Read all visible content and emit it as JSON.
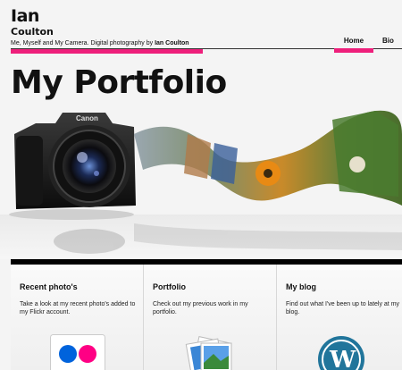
{
  "header": {
    "logo_first": "Ian",
    "logo_last": "Coulton",
    "tagline_text": "Me, Myself and My Camera. Digital photography by ",
    "tagline_name": "Ian Coulton"
  },
  "nav": {
    "items": [
      {
        "label": "Home",
        "active": true
      },
      {
        "label": "Bio",
        "active": false
      }
    ]
  },
  "hero": {
    "title": "My Portfolio",
    "camera_brand": "Canon"
  },
  "boxes": [
    {
      "title": "Recent photo's",
      "text": "Take a look at my recent photo's added to my Flickr account.",
      "icon": "flickr-icon"
    },
    {
      "title": "Portfolio",
      "text": "Check out my previous work in my portfolio.",
      "icon": "photos-stack-icon"
    },
    {
      "title": "My blog",
      "text": "Find out what I've been up to lately at my blog.",
      "icon": "wordpress-icon"
    }
  ],
  "colors": {
    "accent": "#ee1f7b",
    "flickr_blue": "#0063dc",
    "flickr_pink": "#ff0084",
    "wordpress_blue": "#21759b"
  }
}
